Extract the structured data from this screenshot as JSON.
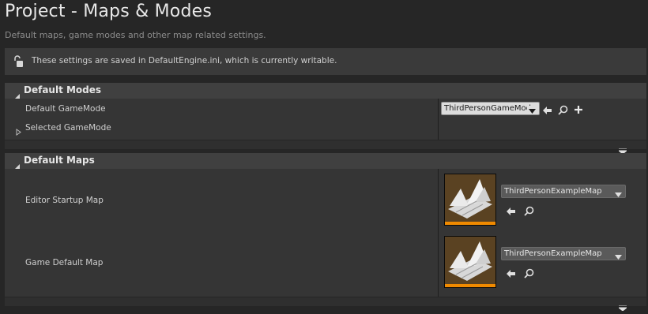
{
  "page": {
    "title": "Project - Maps & Modes",
    "subtitle": "Default maps, game modes and other map related settings."
  },
  "notice": {
    "icon": "unlocked-lock-icon",
    "text": "These settings are saved in DefaultEngine.ini, which is currently writable."
  },
  "default_modes": {
    "header": "Default Modes",
    "default_gamemode_label": "Default GameMode",
    "default_gamemode_value": "ThirdPersonGameMode",
    "selected_gamemode_label": "Selected GameMode"
  },
  "default_maps": {
    "header": "Default Maps",
    "editor_startup_label": "Editor Startup Map",
    "editor_startup_value": "ThirdPersonExampleMap",
    "game_default_label": "Game Default Map",
    "game_default_value": "ThirdPersonExampleMap"
  },
  "colors": {
    "background": "#262626",
    "section_header": "#404040",
    "section_body": "#353535",
    "thumbnail_accent": "#f08a00"
  }
}
